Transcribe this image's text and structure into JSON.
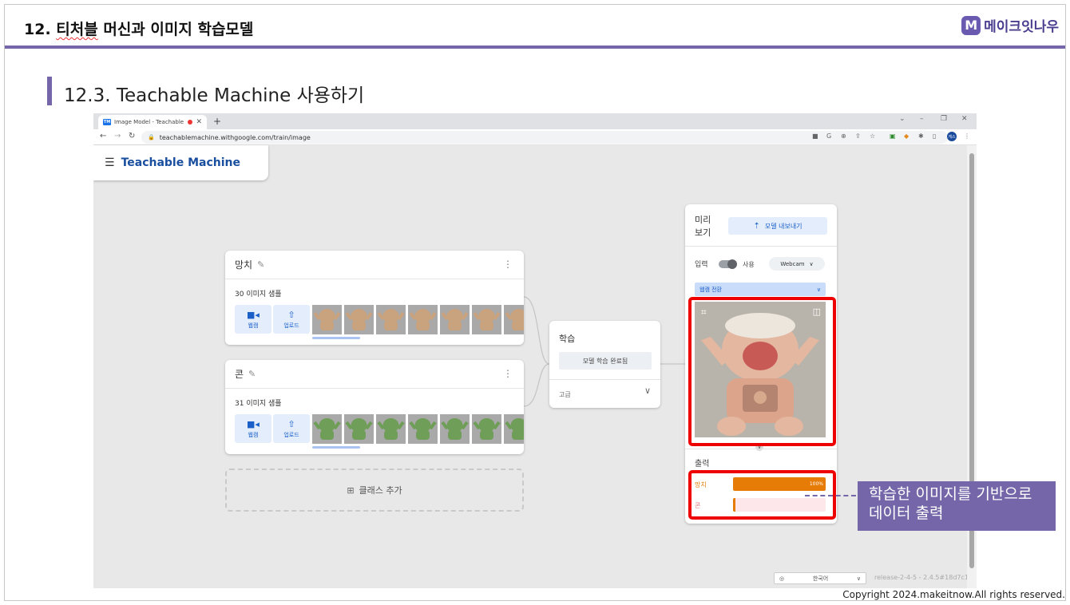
{
  "slide": {
    "title_prefix": "12. ",
    "title_squiggle": "티처블",
    "title_rest": " 머신과 이미지 학습모델",
    "brand_logo": "M",
    "brand_name": "메이크잇나우",
    "section_title": "12.3. Teachable Machine 사용하기",
    "copyright": "Copyright 2024.makeitnow.All rights reserved.",
    "accent_color": "#7466a8"
  },
  "browser": {
    "tab_favicon": "TM",
    "tab_title": "Image Model - Teachable M",
    "tab_close": "✕",
    "new_tab": "+",
    "win_controls": [
      "⌄",
      "–",
      "❐",
      "✕"
    ],
    "url": "teachablemachine.withgoogle.com/train/image",
    "profile_initial": "게스"
  },
  "tm": {
    "brand": "Teachable Machine",
    "classes": [
      {
        "name": "망치",
        "samples": "30 이미지 샘플",
        "thumb_color": "#c9a27e",
        "thumb_count": 7
      },
      {
        "name": "콘",
        "samples": "31 이미지 샘플",
        "thumb_color": "#6f9e58",
        "thumb_count": 7
      }
    ],
    "webcam_label": "웹캠",
    "upload_label": "업로드",
    "add_class": "클래스 추가",
    "training": {
      "title": "학습",
      "button": "모델 학습 완료됨",
      "advanced": "고급"
    },
    "preview": {
      "title": "미리 보기",
      "export": "모델 내보내기",
      "input_label": "입력",
      "toggle_label": "사용",
      "source": "Webcam",
      "switch_webcam": "웹캠 전환",
      "output_label": "출력",
      "outputs": [
        {
          "label": "망치",
          "value": 1.0,
          "value_text": "100%",
          "color": "#e67c06"
        },
        {
          "label": "콘",
          "value": 0.0,
          "value_text": "",
          "color": "#e5737a"
        }
      ]
    },
    "language": "한국어",
    "release": "release-2-4-5 - 2.4.5#18d7c1"
  },
  "annotation": {
    "callout_line1": "학습한 이미지를 기반으로",
    "callout_line2": "데이터 출력",
    "highlight_color": "#ee0000"
  }
}
